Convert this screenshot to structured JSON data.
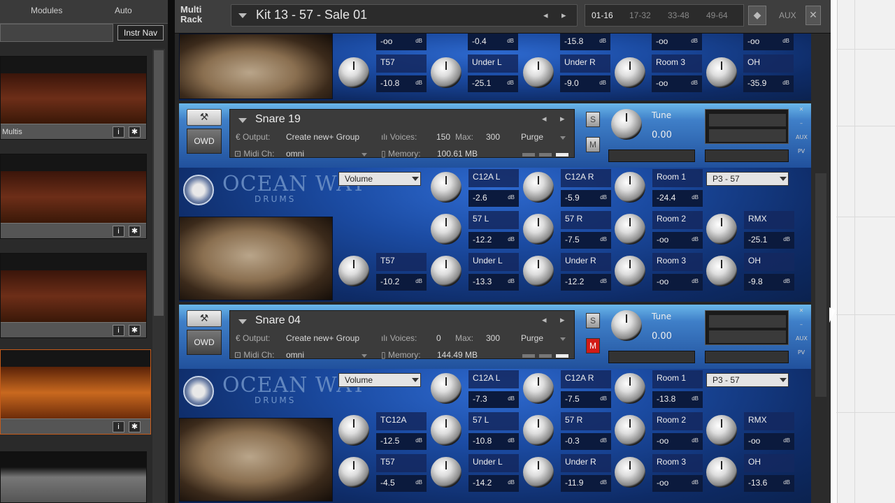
{
  "app": {
    "multirack_label": "Multi\nRack"
  },
  "left_panel": {
    "tabs": [
      "Modules",
      "Auto"
    ],
    "instr_nav_label": "Instr Nav",
    "slot_label": "Multis",
    "info_icon": "i",
    "gear_icon": "✱"
  },
  "header": {
    "kit_title": "Kit 13 - 57 - Sale 01",
    "pages": [
      "01-16",
      "17-32",
      "33-48",
      "49-64"
    ],
    "active_page": "01-16",
    "aux_label": "AUX"
  },
  "partial_instrument": {
    "row1": [
      {
        "value": "-oo"
      },
      {
        "value": "-0.4"
      },
      {
        "value": "-15.8"
      },
      {
        "value": "-oo"
      },
      {
        "value": "-oo"
      }
    ],
    "row2": [
      {
        "name": "T57",
        "value": "-10.8"
      },
      {
        "name": "Under L",
        "value": "-25.1"
      },
      {
        "name": "Under R",
        "value": "-9.0"
      },
      {
        "name": "Room 3",
        "value": "-oo"
      },
      {
        "name": "OH",
        "value": "-35.9"
      }
    ]
  },
  "instruments": [
    {
      "name": "Snare 19",
      "output_label": "Output:",
      "output": "Create new+ Group",
      "voices_label": "Voices:",
      "voices": "150",
      "max_label": "Max:",
      "max": "300",
      "purge": "Purge",
      "midi_label": "Midi Ch:",
      "midi": "omni",
      "memory_label": "Memory:",
      "memory": "100.61 MB",
      "solo": "S",
      "mute": "M",
      "mute_active": false,
      "tune_label": "Tune",
      "tune_value": "0.00",
      "logo": "OCEAN WAY",
      "logo_sub": "DRUMS",
      "volume_label": "Volume",
      "preset": "P3 - 57",
      "channels": [
        {
          "name": "C12A L",
          "value": "-2.6"
        },
        {
          "name": "C12A R",
          "value": "-5.9"
        },
        {
          "name": "Room 1",
          "value": "-24.4"
        },
        {
          "name": "57 L",
          "value": "-12.2"
        },
        {
          "name": "57 R",
          "value": "-7.5"
        },
        {
          "name": "Room 2",
          "value": "-oo"
        },
        {
          "name": "RMX",
          "value": "-25.1"
        },
        {
          "name": "T57",
          "value": "-10.2"
        },
        {
          "name": "Under L",
          "value": "-13.3"
        },
        {
          "name": "Under R",
          "value": "-12.2"
        },
        {
          "name": "Room 3",
          "value": "-oo"
        },
        {
          "name": "OH",
          "value": "-9.8"
        }
      ]
    },
    {
      "name": "Snare 04",
      "output_label": "Output:",
      "output": "Create new+ Group",
      "voices_label": "Voices:",
      "voices": "0",
      "max_label": "Max:",
      "max": "300",
      "purge": "Purge",
      "midi_label": "Midi Ch:",
      "midi": "omni",
      "memory_label": "Memory:",
      "memory": "144.49 MB",
      "solo": "S",
      "mute": "M",
      "mute_active": true,
      "tune_label": "Tune",
      "tune_value": "0.00",
      "logo": "OCEAN WAY",
      "logo_sub": "DRUMS",
      "volume_label": "Volume",
      "preset": "P3 - 57",
      "channels": [
        {
          "name": "C12A L",
          "value": "-7.3"
        },
        {
          "name": "C12A R",
          "value": "-7.5"
        },
        {
          "name": "Room 1",
          "value": "-13.8"
        },
        {
          "name": "TC12A",
          "value": "-12.5"
        },
        {
          "name": "57 L",
          "value": "-10.8"
        },
        {
          "name": "57 R",
          "value": "-0.3"
        },
        {
          "name": "Room 2",
          "value": "-oo"
        },
        {
          "name": "RMX",
          "value": "-oo"
        },
        {
          "name": "T57",
          "value": "-4.5"
        },
        {
          "name": "Under L",
          "value": "-14.2"
        },
        {
          "name": "Under R",
          "value": "-11.9"
        },
        {
          "name": "Room 3",
          "value": "-oo"
        },
        {
          "name": "OH",
          "value": "-13.6"
        }
      ]
    }
  ],
  "db_unit": "dB",
  "colors": {
    "mute_active": "#d21b16",
    "panel_blue": "#1b4ba2"
  }
}
